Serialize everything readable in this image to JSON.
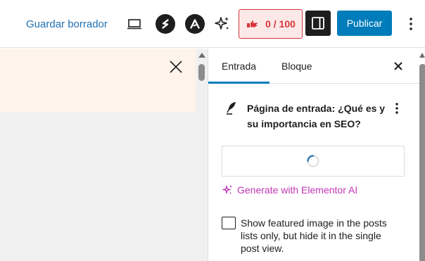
{
  "header": {
    "save_draft_label": "Guardar borrador",
    "seo_score": "0 / 100",
    "publish_label": "Publicar"
  },
  "sidebar": {
    "tabs": [
      {
        "label": "Entrada",
        "active": true
      },
      {
        "label": "Bloque",
        "active": false
      }
    ],
    "post_title": "Página de entrada: ¿Qué es y su importancia en SEO?",
    "elementor_ai_label": "Generate with Elementor AI",
    "featured_image_option": "Show featured image in the posts lists only, but hide it in the single post view."
  },
  "icons": [
    "desktop-preview-icon",
    "s-brand-icon",
    "a-brand-icon",
    "sparkles-icon",
    "seo-hand-icon",
    "sidebar-panel-icon",
    "more-vertical-icon",
    "close-icon",
    "feather-icon",
    "spinner-icon"
  ],
  "colors": {
    "accent": "#007cba",
    "seo_bad": "#d63638",
    "notice_bg": "#fef4e9",
    "elementor_pink": "#c036b5"
  }
}
